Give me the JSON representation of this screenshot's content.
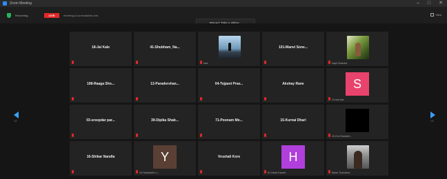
{
  "window": {
    "title": "Zoom Meeting"
  },
  "window_controls": {
    "minimize": "–",
    "maximize": "□",
    "close": "✕"
  },
  "toolbar": {
    "recording_text": "Recording...",
    "live_label": "LIVE",
    "meeting_id": "meeting-id-unreadable-info",
    "notice": "Pinned: Take a sitting...",
    "view_label": "View"
  },
  "nav": {
    "prev_label": "1/2",
    "next_label": "1/2"
  },
  "tiles": [
    {
      "type": "name",
      "name": "18-Jai Kale"
    },
    {
      "type": "name",
      "name": "41-Shubham_Na..."
    },
    {
      "type": "photo",
      "photo": "mountain",
      "caption": "kavi"
    },
    {
      "type": "name",
      "name": "101-Manvi Sone..."
    },
    {
      "type": "photo",
      "photo": "green",
      "caption": "Kapil Chandra"
    },
    {
      "type": "name",
      "name": "108-Raaga Sho..."
    },
    {
      "type": "name",
      "name": "13-Paradershan..."
    },
    {
      "type": "name",
      "name": "04-Tejpani Prav..."
    },
    {
      "type": "name",
      "name": "Akshay Rane"
    },
    {
      "type": "letter",
      "letter": "S",
      "color": "#e8436c",
      "caption": "12-ruel sae"
    },
    {
      "type": "name",
      "name": "03-sreepdar par..."
    },
    {
      "type": "name",
      "name": "39-Dipika Shab..."
    },
    {
      "type": "name",
      "name": "71-Poonam Mo..."
    },
    {
      "type": "name",
      "name": "15-Kurnai Dhari"
    },
    {
      "type": "black",
      "caption": "23-Om Chandrel..."
    },
    {
      "type": "name",
      "name": "16-Shikar Nandla"
    },
    {
      "type": "letter",
      "letter": "Y",
      "color": "#5a3f35",
      "caption": "34-Yashwanth Li..."
    },
    {
      "type": "name",
      "name": "Vrushali Kore"
    },
    {
      "type": "letter",
      "letter": "H",
      "color": "#b03fdb",
      "caption": "61-Harsh Kanvel"
    },
    {
      "type": "photo",
      "photo": "woman",
      "caption": "Manvi Tumsheve"
    }
  ]
}
